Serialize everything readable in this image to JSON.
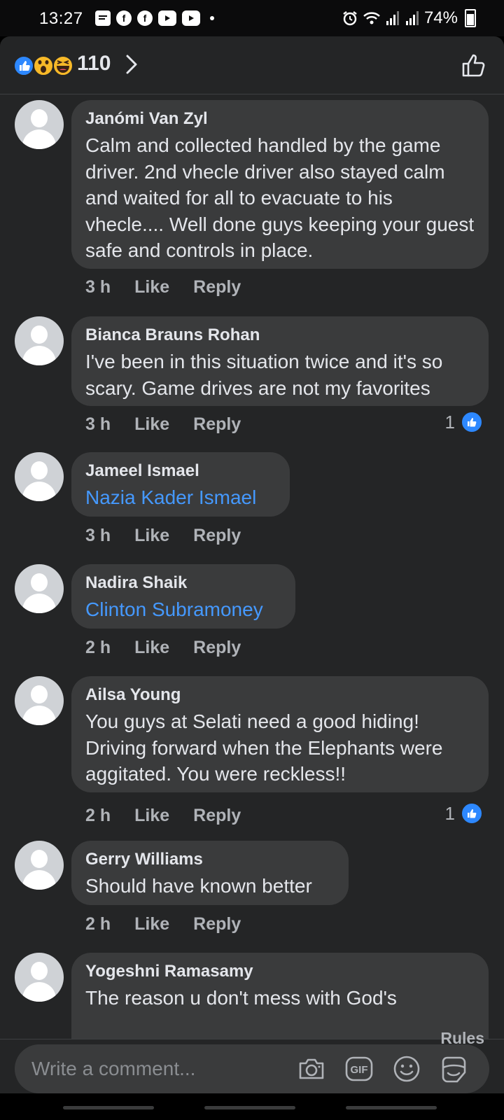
{
  "status_bar": {
    "time": "13:27",
    "battery": "74%"
  },
  "header": {
    "reaction_count": "110"
  },
  "comments": [
    {
      "name": "Janómi Van Zyl",
      "text": "Calm and collected handled by the game driver. 2nd vhecle driver also stayed calm and waited for all to evacuate to his vhecle.... Well done guys keeping your guest safe and controls in place.",
      "time": "3 h",
      "like": "Like",
      "reply": "Reply"
    },
    {
      "name": "Bianca Brauns Rohan",
      "text": "I've been in this situation twice and it's so scary. Game drives are not my favorites",
      "time": "3 h",
      "like": "Like",
      "reply": "Reply",
      "likes": "1"
    },
    {
      "name": "Jameel Ismael",
      "text": "Nazia Kader Ismael",
      "time": "3 h",
      "like": "Like",
      "reply": "Reply"
    },
    {
      "name": "Nadira Shaik",
      "text": "Clinton Subramoney",
      "time": "2 h",
      "like": "Like",
      "reply": "Reply"
    },
    {
      "name": "Ailsa Young",
      "text": "You guys at Selati need a good hiding! Driving forward when the Elephants were aggitated. You were reckless!!",
      "time": "2 h",
      "like": "Like",
      "reply": "Reply",
      "likes": "1"
    },
    {
      "name": "Gerry Williams",
      "text": "Should have known better",
      "time": "2 h",
      "like": "Like",
      "reply": "Reply"
    },
    {
      "name": "Yogeshni Ramasamy",
      "text": "The reason u don't mess with God's"
    }
  ],
  "footer": {
    "rules": "Rules",
    "placeholder": "Write a comment..."
  },
  "colors": {
    "background": "#242526",
    "bubble": "#3a3b3c",
    "link": "#4599ff",
    "like_blue": "#2d88ff"
  },
  "icons": [
    "message-icon",
    "facebook-icon",
    "youtube-icon",
    "alarm-icon",
    "wifi-icon",
    "signal-icon",
    "battery-icon",
    "like-reaction-icon",
    "wow-reaction-icon",
    "haha-reaction-icon",
    "chevron-right-icon",
    "thumbs-up-icon",
    "camera-icon",
    "gif-icon",
    "emoji-icon",
    "sticker-icon"
  ]
}
